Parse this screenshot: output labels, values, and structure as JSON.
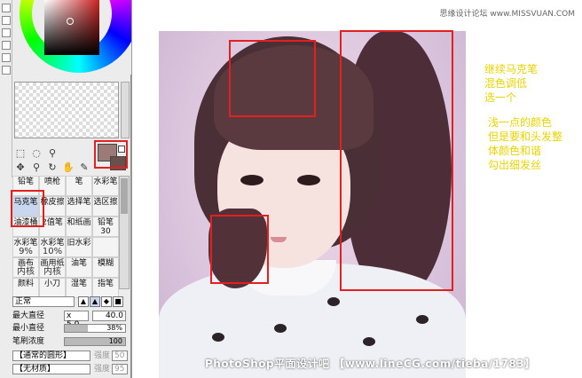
{
  "tool_panel": {
    "preview_label": "",
    "tool_icons": [
      "selection-rect-icon",
      "lasso-icon",
      "magic-wand-icon",
      "move-icon",
      "zoom-icon",
      "rotate-icon",
      "hand-icon",
      "eyedropper-icon"
    ],
    "brushes": [
      {
        "label": "铅笔",
        "icon": "pencil-icon"
      },
      {
        "label": "喷枪",
        "icon": "airbrush-icon"
      },
      {
        "label": "笔",
        "icon": "pen-icon"
      },
      {
        "label": "水彩笔",
        "icon": "watercolor-icon"
      },
      {
        "label": "马克笔",
        "icon": "marker-icon",
        "selected": true
      },
      {
        "label": "橡皮擦",
        "icon": "eraser-icon"
      },
      {
        "label": "选择笔",
        "icon": "select-pen-icon"
      },
      {
        "label": "选区擦",
        "icon": "select-eraser-icon"
      },
      {
        "label": "油漆桶",
        "icon": "bucket-icon"
      },
      {
        "label": "2值笔",
        "icon": "binary-pen-icon"
      },
      {
        "label": "和纸画",
        "icon": "paper-icon"
      },
      {
        "label": "铅笔30",
        "icon": "pencil30-icon"
      },
      {
        "label": "水彩笔",
        "icon": "watercolor-icon"
      },
      {
        "label": "水彩笔",
        "icon": "watercolor-icon"
      },
      {
        "label": "旧水彩",
        "icon": "old-watercolor-icon"
      },
      {
        "label": "",
        "icon": "blank-icon"
      },
      {
        "label": "画布",
        "icon": "canvas-icon"
      },
      {
        "label": "画用纸",
        "icon": "drawing-paper-icon"
      },
      {
        "label": "油笔",
        "icon": "oil-pen-icon"
      },
      {
        "label": "模糊",
        "icon": "blur-icon"
      },
      {
        "label": "颜料",
        "icon": "paint-icon"
      },
      {
        "label": "小刀",
        "icon": "knife-icon"
      },
      {
        "label": "湿笔",
        "icon": "wet-pen-icon"
      },
      {
        "label": "指笔",
        "icon": "finger-icon"
      }
    ],
    "brush_sublabels": [
      "",
      "",
      "",
      "",
      "",
      "",
      "",
      "",
      "",
      "",
      "",
      "",
      "9%",
      "10%",
      "",
      "",
      "内核",
      "内核",
      "",
      "",
      "",
      "",
      "",
      ""
    ],
    "blend_mode": "正常",
    "max_diameter_label": "最大直径",
    "max_diameter_multiplier": "x 5.0",
    "max_diameter_value": "40.0",
    "min_diameter_label": "最小直径",
    "min_diameter_value": "38%",
    "min_diameter_fraction": 0.38,
    "density_label": "笔刷浓度",
    "density_value": "100",
    "density_fraction": 1.0,
    "shape_select": "【通常的圆形】",
    "shape_strength_label": "强度",
    "shape_strength_value": "50",
    "texture_select": "【无材质】",
    "texture_strength_label": "强度",
    "texture_strength_value": "95"
  },
  "canvas": {
    "notes_group1": [
      "继续马克笔",
      "混色调低",
      "选一个"
    ],
    "notes_group2": [
      "浅一点的颜色",
      "但是要和头发整",
      "体颜色和谐",
      "勾出细发丝"
    ],
    "watermark_top": "思缘设计论坛 www.MISSVUAN.COM",
    "watermark_bottom": "PhotoShop平面设计吧 【www.lineCG.com/tieba/1783】"
  },
  "colors": {
    "highlight": "#e32020",
    "note_text": "#e8d300",
    "main_color": "#9a7b76"
  }
}
